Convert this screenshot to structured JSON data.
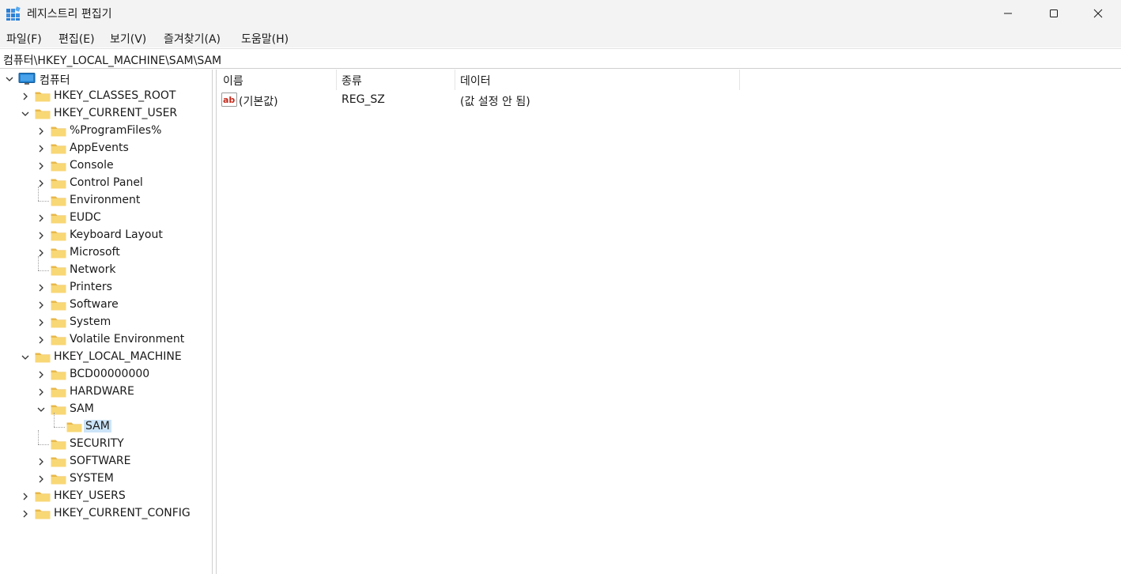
{
  "window": {
    "title": "레지스트리 편집기",
    "colors": {
      "titlebar": "#f3f3f3",
      "selection": "#cce4f7",
      "folder": "#f8d775",
      "folder_dark": "#e8b84a",
      "monitor": "#1f7fd0"
    }
  },
  "menu": {
    "items": [
      "파일(F)",
      "편집(E)",
      "보기(V)",
      "즐겨찾기(A)",
      "도움말(H)"
    ]
  },
  "address": {
    "path": "컴퓨터\\HKEY_LOCAL_MACHINE\\SAM\\SAM"
  },
  "tree": {
    "root": "컴퓨터",
    "nodes": [
      {
        "label": "HKEY_CLASSES_ROOT",
        "toggle": "collapsed"
      },
      {
        "label": "HKEY_CURRENT_USER",
        "toggle": "expanded"
      },
      {
        "label": "%ProgramFiles%",
        "toggle": "collapsed"
      },
      {
        "label": "AppEvents",
        "toggle": "collapsed"
      },
      {
        "label": "Console",
        "toggle": "collapsed"
      },
      {
        "label": "Control Panel",
        "toggle": "collapsed"
      },
      {
        "label": "Environment",
        "toggle": "none"
      },
      {
        "label": "EUDC",
        "toggle": "collapsed"
      },
      {
        "label": "Keyboard Layout",
        "toggle": "collapsed"
      },
      {
        "label": "Microsoft",
        "toggle": "collapsed"
      },
      {
        "label": "Network",
        "toggle": "none"
      },
      {
        "label": "Printers",
        "toggle": "collapsed"
      },
      {
        "label": "Software",
        "toggle": "collapsed"
      },
      {
        "label": "System",
        "toggle": "collapsed"
      },
      {
        "label": "Volatile Environment",
        "toggle": "collapsed"
      },
      {
        "label": "HKEY_LOCAL_MACHINE",
        "toggle": "expanded"
      },
      {
        "label": "BCD00000000",
        "toggle": "collapsed"
      },
      {
        "label": "HARDWARE",
        "toggle": "collapsed"
      },
      {
        "label": "SAM",
        "toggle": "expanded"
      },
      {
        "label": "SAM",
        "toggle": "none",
        "selected": true
      },
      {
        "label": "SECURITY",
        "toggle": "none"
      },
      {
        "label": "SOFTWARE",
        "toggle": "collapsed"
      },
      {
        "label": "SYSTEM",
        "toggle": "collapsed"
      },
      {
        "label": "HKEY_USERS",
        "toggle": "collapsed"
      },
      {
        "label": "HKEY_CURRENT_CONFIG",
        "toggle": "collapsed"
      }
    ]
  },
  "list": {
    "columns": [
      "이름",
      "종류",
      "데이터"
    ],
    "rows": [
      {
        "icon": "string-value-icon",
        "icon_text": "ab",
        "name": "(기본값)",
        "type": "REG_SZ",
        "data": "(값 설정 안 됨)"
      }
    ]
  }
}
